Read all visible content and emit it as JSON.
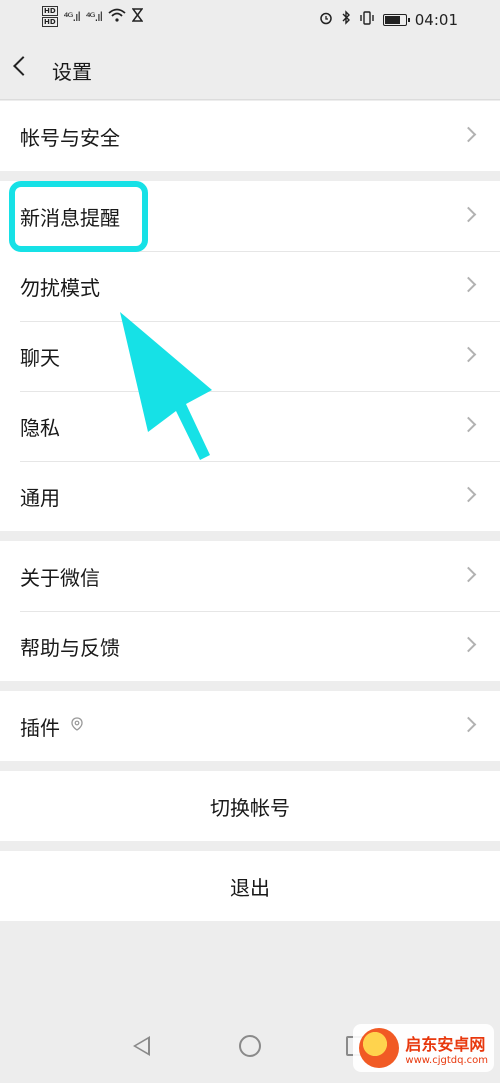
{
  "status_bar": {
    "time": "04:01",
    "network_left": "HD",
    "signal_1": "⁴ᴳ.ıl",
    "signal_2": "⁴ᴳ.ıl"
  },
  "nav": {
    "title": "设置"
  },
  "groups": [
    {
      "items": [
        "帐号与安全"
      ]
    },
    {
      "items": [
        "新消息提醒",
        "勿扰模式",
        "聊天",
        "隐私",
        "通用"
      ]
    },
    {
      "items": [
        "关于微信",
        "帮助与反馈"
      ]
    },
    {
      "items": [
        "插件"
      ]
    }
  ],
  "buttons": {
    "switch_account": "切换帐号",
    "logout": "退出"
  },
  "annotation": {
    "color": "#16e1e6"
  },
  "watermark": {
    "name": "启东安卓网",
    "url": "www.cjgtdq.com"
  },
  "icons": {
    "back": "chevron-left-icon",
    "row": "chevron-right-icon",
    "plugin": "plugin-status-icon",
    "sys_back": "triangle-back-icon",
    "sys_home": "circle-home-icon",
    "sys_recent": "square-recent-icon"
  }
}
